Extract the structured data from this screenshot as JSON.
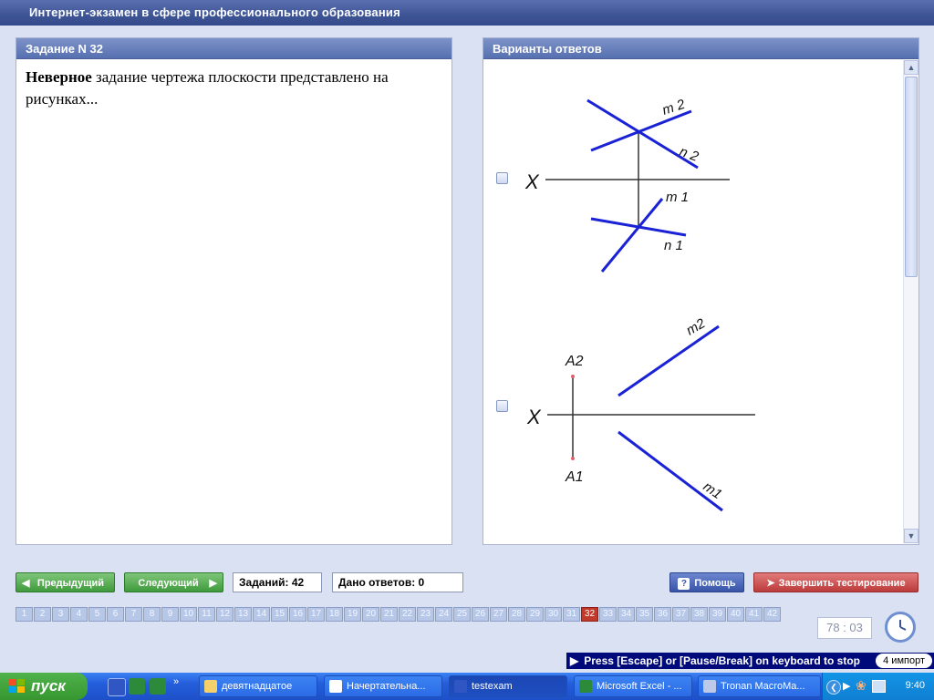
{
  "window": {
    "title": "Интернет-экзамен в сфере профессионального образования"
  },
  "task_panel": {
    "header": "Задание N 32",
    "question_bold": "Неверное",
    "question_rest": " задание чертежа плоскости представлено на рисунках..."
  },
  "answers_panel": {
    "header": "Варианты ответов",
    "option1": {
      "x_label": "X",
      "m2": "m 2",
      "n2": "n 2",
      "m1": "m 1",
      "n1": "n 1"
    },
    "option2": {
      "x_label": "X",
      "a2": "A2",
      "a1": "A1",
      "m2": "m2",
      "m1": "m1"
    }
  },
  "nav": {
    "prev_label": "Предыдущий",
    "next_label": "Следующий",
    "tasks_count": "Заданий: 42",
    "answers_given": "Дано ответов: 0",
    "help_label": "Помощь",
    "finish_label": "Завершить тестирование"
  },
  "question_numbers": [
    "1",
    "2",
    "3",
    "4",
    "5",
    "6",
    "7",
    "8",
    "9",
    "10",
    "11",
    "12",
    "13",
    "14",
    "15",
    "16",
    "17",
    "18",
    "19",
    "20",
    "21",
    "22",
    "23",
    "24",
    "25",
    "26",
    "27",
    "28",
    "29",
    "30",
    "31",
    "32",
    "33",
    "34",
    "35",
    "36",
    "37",
    "38",
    "39",
    "40",
    "41",
    "42"
  ],
  "current_question": "32",
  "timer": "78 : 03",
  "escape_bar": {
    "text": "Press [Escape] or [Pause/Break] on keyboard to stop",
    "badge": "4 импорт"
  },
  "taskbar": {
    "start_label": "пуск",
    "tasks": [
      {
        "label": "девятнадцатое",
        "icon": "folder-icon",
        "active": false
      },
      {
        "label": "Начертательна...",
        "icon": "word-icon",
        "active": false
      },
      {
        "label": "testexam",
        "icon": "app-icon",
        "active": true
      },
      {
        "label": "Microsoft Excel - ...",
        "icon": "excel-icon",
        "active": false
      },
      {
        "label": "Tronan MacroMa...",
        "icon": "macro-icon",
        "active": false
      }
    ],
    "clock": "9:40"
  },
  "colors": {
    "line_blue": "#1a22d6",
    "active_number": "#c0392b",
    "title_bar": "#3e5595"
  }
}
